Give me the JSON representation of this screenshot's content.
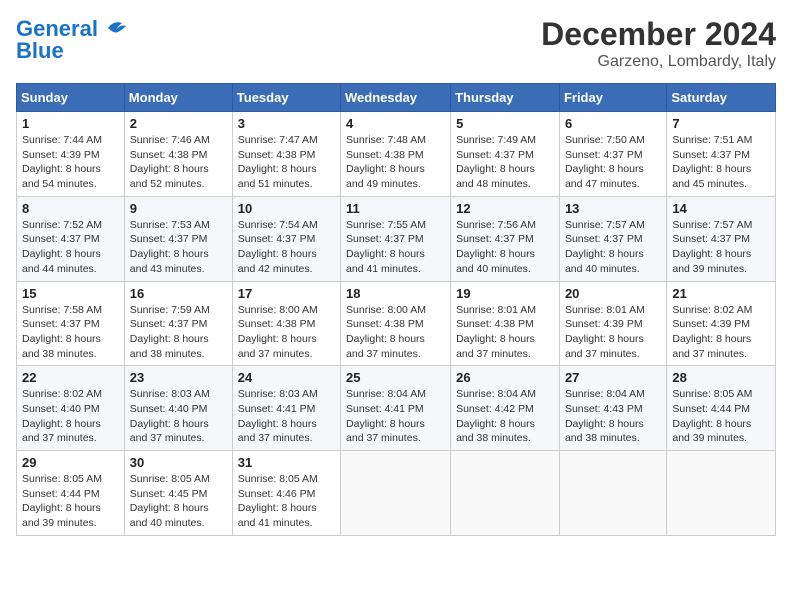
{
  "logo": {
    "line1": "General",
    "line2": "Blue"
  },
  "title": "December 2024",
  "subtitle": "Garzeno, Lombardy, Italy",
  "days_of_week": [
    "Sunday",
    "Monday",
    "Tuesday",
    "Wednesday",
    "Thursday",
    "Friday",
    "Saturday"
  ],
  "weeks": [
    [
      {
        "day": "1",
        "info": "Sunrise: 7:44 AM\nSunset: 4:39 PM\nDaylight: 8 hours\nand 54 minutes."
      },
      {
        "day": "2",
        "info": "Sunrise: 7:46 AM\nSunset: 4:38 PM\nDaylight: 8 hours\nand 52 minutes."
      },
      {
        "day": "3",
        "info": "Sunrise: 7:47 AM\nSunset: 4:38 PM\nDaylight: 8 hours\nand 51 minutes."
      },
      {
        "day": "4",
        "info": "Sunrise: 7:48 AM\nSunset: 4:38 PM\nDaylight: 8 hours\nand 49 minutes."
      },
      {
        "day": "5",
        "info": "Sunrise: 7:49 AM\nSunset: 4:37 PM\nDaylight: 8 hours\nand 48 minutes."
      },
      {
        "day": "6",
        "info": "Sunrise: 7:50 AM\nSunset: 4:37 PM\nDaylight: 8 hours\nand 47 minutes."
      },
      {
        "day": "7",
        "info": "Sunrise: 7:51 AM\nSunset: 4:37 PM\nDaylight: 8 hours\nand 45 minutes."
      }
    ],
    [
      {
        "day": "8",
        "info": "Sunrise: 7:52 AM\nSunset: 4:37 PM\nDaylight: 8 hours\nand 44 minutes."
      },
      {
        "day": "9",
        "info": "Sunrise: 7:53 AM\nSunset: 4:37 PM\nDaylight: 8 hours\nand 43 minutes."
      },
      {
        "day": "10",
        "info": "Sunrise: 7:54 AM\nSunset: 4:37 PM\nDaylight: 8 hours\nand 42 minutes."
      },
      {
        "day": "11",
        "info": "Sunrise: 7:55 AM\nSunset: 4:37 PM\nDaylight: 8 hours\nand 41 minutes."
      },
      {
        "day": "12",
        "info": "Sunrise: 7:56 AM\nSunset: 4:37 PM\nDaylight: 8 hours\nand 40 minutes."
      },
      {
        "day": "13",
        "info": "Sunrise: 7:57 AM\nSunset: 4:37 PM\nDaylight: 8 hours\nand 40 minutes."
      },
      {
        "day": "14",
        "info": "Sunrise: 7:57 AM\nSunset: 4:37 PM\nDaylight: 8 hours\nand 39 minutes."
      }
    ],
    [
      {
        "day": "15",
        "info": "Sunrise: 7:58 AM\nSunset: 4:37 PM\nDaylight: 8 hours\nand 38 minutes."
      },
      {
        "day": "16",
        "info": "Sunrise: 7:59 AM\nSunset: 4:37 PM\nDaylight: 8 hours\nand 38 minutes."
      },
      {
        "day": "17",
        "info": "Sunrise: 8:00 AM\nSunset: 4:38 PM\nDaylight: 8 hours\nand 37 minutes."
      },
      {
        "day": "18",
        "info": "Sunrise: 8:00 AM\nSunset: 4:38 PM\nDaylight: 8 hours\nand 37 minutes."
      },
      {
        "day": "19",
        "info": "Sunrise: 8:01 AM\nSunset: 4:38 PM\nDaylight: 8 hours\nand 37 minutes."
      },
      {
        "day": "20",
        "info": "Sunrise: 8:01 AM\nSunset: 4:39 PM\nDaylight: 8 hours\nand 37 minutes."
      },
      {
        "day": "21",
        "info": "Sunrise: 8:02 AM\nSunset: 4:39 PM\nDaylight: 8 hours\nand 37 minutes."
      }
    ],
    [
      {
        "day": "22",
        "info": "Sunrise: 8:02 AM\nSunset: 4:40 PM\nDaylight: 8 hours\nand 37 minutes."
      },
      {
        "day": "23",
        "info": "Sunrise: 8:03 AM\nSunset: 4:40 PM\nDaylight: 8 hours\nand 37 minutes."
      },
      {
        "day": "24",
        "info": "Sunrise: 8:03 AM\nSunset: 4:41 PM\nDaylight: 8 hours\nand 37 minutes."
      },
      {
        "day": "25",
        "info": "Sunrise: 8:04 AM\nSunset: 4:41 PM\nDaylight: 8 hours\nand 37 minutes."
      },
      {
        "day": "26",
        "info": "Sunrise: 8:04 AM\nSunset: 4:42 PM\nDaylight: 8 hours\nand 38 minutes."
      },
      {
        "day": "27",
        "info": "Sunrise: 8:04 AM\nSunset: 4:43 PM\nDaylight: 8 hours\nand 38 minutes."
      },
      {
        "day": "28",
        "info": "Sunrise: 8:05 AM\nSunset: 4:44 PM\nDaylight: 8 hours\nand 39 minutes."
      }
    ],
    [
      {
        "day": "29",
        "info": "Sunrise: 8:05 AM\nSunset: 4:44 PM\nDaylight: 8 hours\nand 39 minutes."
      },
      {
        "day": "30",
        "info": "Sunrise: 8:05 AM\nSunset: 4:45 PM\nDaylight: 8 hours\nand 40 minutes."
      },
      {
        "day": "31",
        "info": "Sunrise: 8:05 AM\nSunset: 4:46 PM\nDaylight: 8 hours\nand 41 minutes."
      },
      null,
      null,
      null,
      null
    ]
  ]
}
